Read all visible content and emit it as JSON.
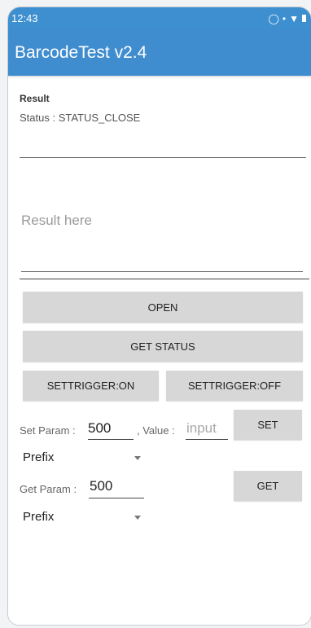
{
  "statusbar": {
    "time": "12:43"
  },
  "appbar": {
    "title": "BarcodeTest v2.4"
  },
  "result": {
    "heading": "Result",
    "status": "Status : STATUS_CLOSE",
    "placeholder": "Result here"
  },
  "buttons": {
    "open": "OPEN",
    "get_status": "GET STATUS",
    "settrigger_on": "SETTRIGGER:ON",
    "settrigger_off": "SETTRIGGER:OFF",
    "set": "SET",
    "get": "GET"
  },
  "set_param": {
    "label": "Set Param :",
    "value": "500",
    "value_label": ", Value :",
    "input_placeholder": "input",
    "spinner": "Prefix"
  },
  "get_param": {
    "label": "Get Param :",
    "value": "500",
    "spinner": "Prefix"
  },
  "colors": {
    "appbar": "#3f8ccf",
    "button": "#d7d7d7"
  }
}
